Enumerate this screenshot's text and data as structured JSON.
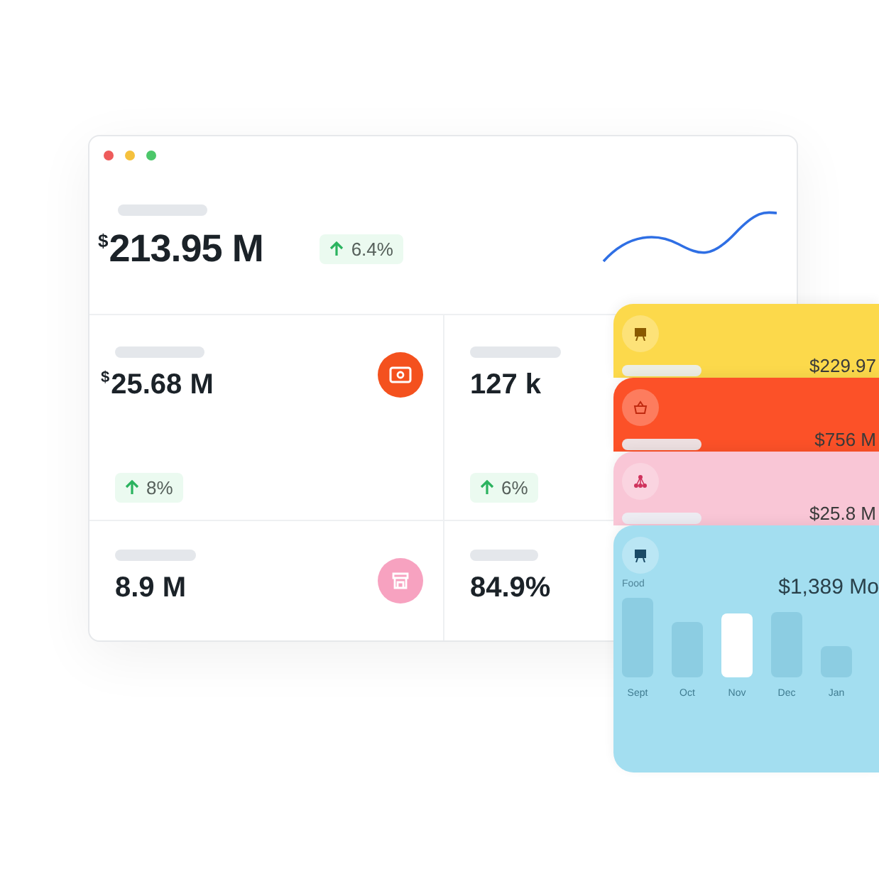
{
  "headline": {
    "currency": "$",
    "value": "213.95 M",
    "change": "6.4%"
  },
  "metrics": [
    {
      "currency": "$",
      "value": "25.68 M",
      "change": "8%"
    },
    {
      "value": "127 k",
      "change": "6%"
    },
    {
      "value": "8.9 M"
    },
    {
      "value": "84.9%"
    }
  ],
  "cards": [
    {
      "color": "#fcd94b",
      "amount": "$229.97"
    },
    {
      "color": "#fc5128",
      "amount": "$756 M"
    },
    {
      "color": "#f9c6d6",
      "amount": "$25.8 M"
    },
    {
      "color": "#a3def0",
      "label": "Food",
      "amount": "$1,389 Mo",
      "bars": [
        {
          "label": "Sept",
          "selected": false
        },
        {
          "label": "Oct",
          "selected": false
        },
        {
          "label": "Nov",
          "selected": true
        },
        {
          "label": "Dec",
          "selected": false
        },
        {
          "label": "Jan",
          "selected": false
        }
      ]
    }
  ]
}
